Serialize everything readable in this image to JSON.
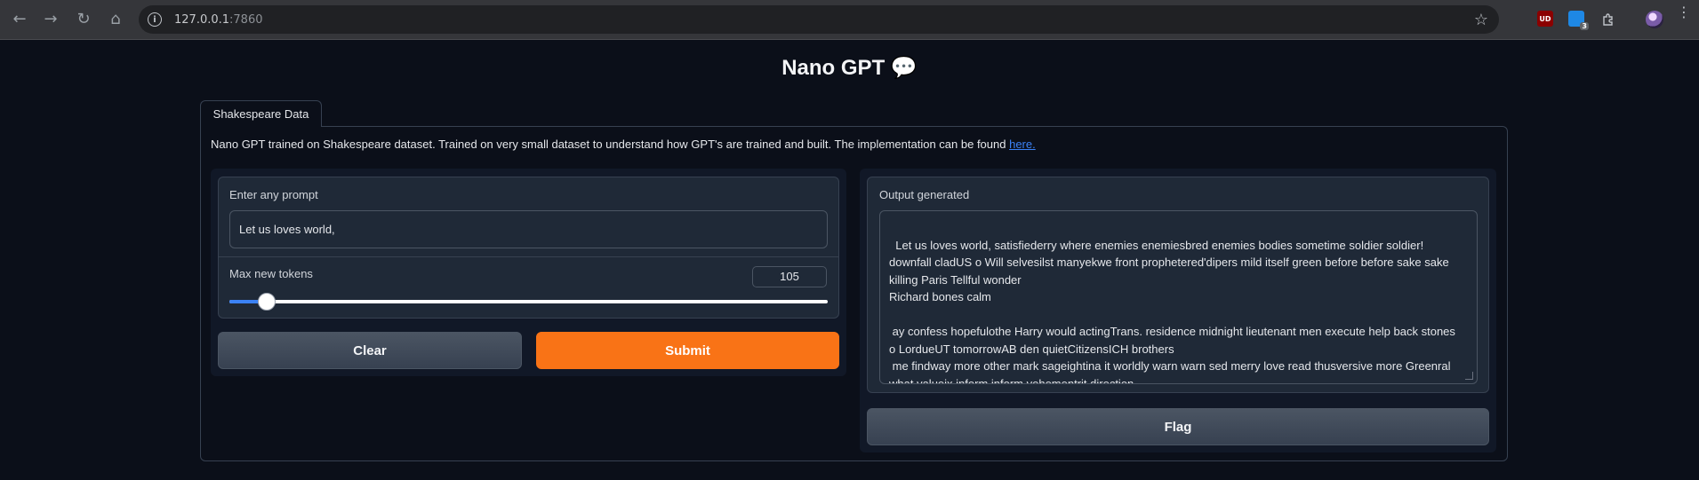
{
  "browser": {
    "url_host": "127.0.0.1",
    "url_port": ":7860",
    "extension_badge": "3",
    "ublock_label": "UD"
  },
  "app": {
    "title": "Nano GPT 💬",
    "tab_label": "Shakespeare Data",
    "description": "Nano GPT trained on Shakespeare dataset. Trained on very small dataset to understand how GPT's are trained and built. The implementation can be found ",
    "description_link": "here."
  },
  "inputs": {
    "prompt_label": "Enter any prompt",
    "prompt_value": "Let us loves world,",
    "max_tokens_label": "Max new tokens",
    "max_tokens_value": "105",
    "slider_fraction": 0.05,
    "clear_label": "Clear",
    "submit_label": "Submit"
  },
  "output": {
    "label": "Output generated",
    "text": "Let us loves world, satisfiederry where enemies enemiesbred enemies bodies sometime soldier soldier!\ndownfall cladUS o Will selvesilst manyekwe front prophetered'dipers mild itself green before before sake sake\nkilling Paris Tellful wonder\nRichard bones calm\n\n ay confess hopefulothe Harry would actingTrans. residence midnight lieutenant men execute help back stones\no LordueUT tomorrowAB den quietCitizensICH brothers\n me findway more other mark sageightina it worldly warn warn sed merry love read thusversive more Greenral\nwhat valueix inform inform vehementrit direction",
    "flag_label": "Flag"
  }
}
